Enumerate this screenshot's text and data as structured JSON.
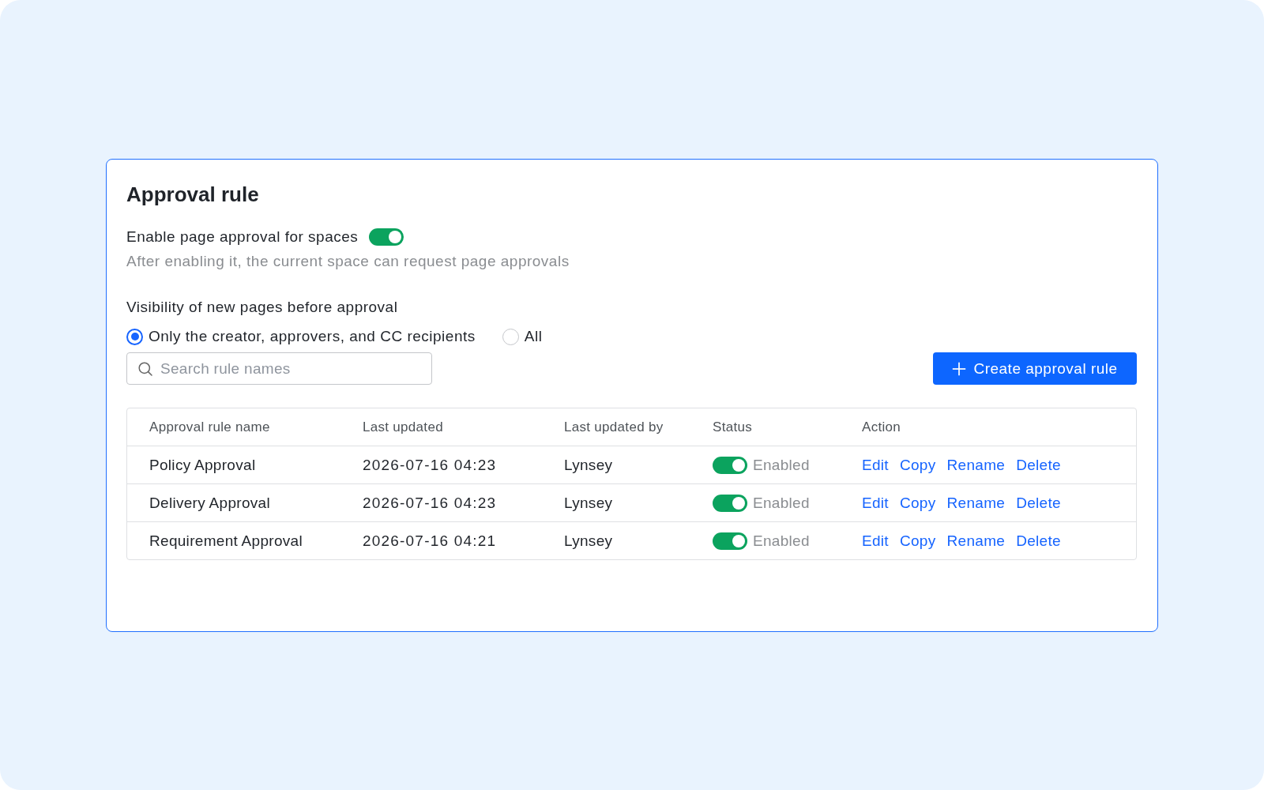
{
  "page": {
    "title": "Approval rule"
  },
  "approval_setting": {
    "label": "Enable page approval for spaces",
    "on": true,
    "description": "After enabling it, the current space can request page approvals"
  },
  "visibility": {
    "label": "Visibility of new pages before approval",
    "options": [
      {
        "label": "Only the creator, approvers, and CC recipients",
        "selected": true
      },
      {
        "label": "All",
        "selected": false
      }
    ]
  },
  "search": {
    "placeholder": "Search rule names"
  },
  "create_button": {
    "label": "Create approval rule"
  },
  "table": {
    "columns": [
      "Approval rule name",
      "Last updated",
      "Last updated by",
      "Status",
      "Action"
    ],
    "rows": [
      {
        "name": "Policy Approval",
        "last_updated": "2026-07-16 04:23",
        "last_updated_by": "Lynsey",
        "status": {
          "on": true,
          "label": "Enabled"
        },
        "actions": [
          "Edit",
          "Copy",
          "Rename",
          "Delete"
        ]
      },
      {
        "name": "Delivery Approval",
        "last_updated": "2026-07-16 04:23",
        "last_updated_by": "Lynsey",
        "status": {
          "on": true,
          "label": "Enabled"
        },
        "actions": [
          "Edit",
          "Copy",
          "Rename",
          "Delete"
        ]
      },
      {
        "name": "Requirement Approval",
        "last_updated": "2026-07-16 04:21",
        "last_updated_by": "Lynsey",
        "status": {
          "on": true,
          "label": "Enabled"
        },
        "actions": [
          "Edit",
          "Copy",
          "Rename",
          "Delete"
        ]
      }
    ]
  }
}
